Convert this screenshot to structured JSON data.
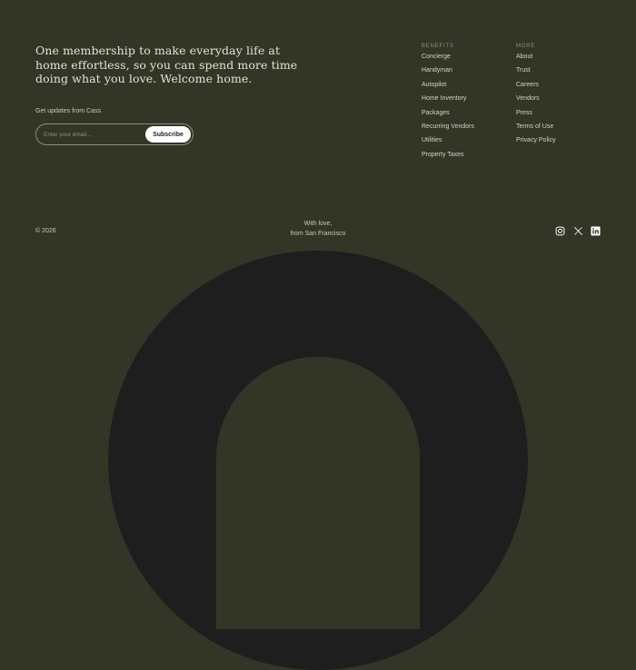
{
  "footer": {
    "tagline": "One membership to make everyday life at home effortless, so you can spend more time doing what you love. Welcome home.",
    "newsletter": {
      "label": "Get updates from Cass",
      "placeholder": "Enter your email...",
      "subscribe_label": "Subscribe"
    },
    "benefits": {
      "title": "BENEFITS",
      "links": [
        "Concierge",
        "Handyman",
        "Autopilot",
        "Home Inventory",
        "Packages",
        "Recurring Vendors",
        "Utilities",
        "Property Taxes"
      ]
    },
    "more": {
      "title": "MORE",
      "links": [
        "About",
        "Trust",
        "Careers",
        "Vendors",
        "Press",
        "Terms of Use",
        "Privacy Policy"
      ]
    },
    "copyright": "© 2026",
    "with_love": [
      "With love,",
      "from San Francisco"
    ],
    "social": [
      "instagram-icon",
      "x-icon",
      "linkedin-icon"
    ]
  },
  "colors": {
    "background": "#333627",
    "arch": "#1e1e1e",
    "button": "#ffffff"
  }
}
